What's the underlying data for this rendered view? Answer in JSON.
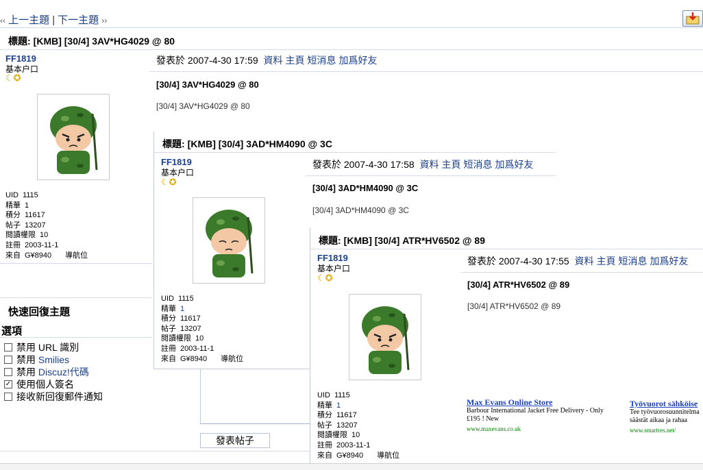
{
  "nav": {
    "prev_arrow": "‹‹",
    "prev_topic": "上一主題",
    "divider": "|",
    "next_topic": "下一主題",
    "next_arrow": "››"
  },
  "posts": [
    {
      "title_label": "標題:",
      "title": "[KMB] [30/4] 3AV*HG4029 @ 80",
      "username": "FF1819",
      "usergroup": "基本户口",
      "stats": [
        {
          "label": "UID",
          "value": "1115"
        },
        {
          "label": "精華",
          "value": "1"
        },
        {
          "label": "積分",
          "value": "11617"
        },
        {
          "label": "帖子",
          "value": "13207"
        },
        {
          "label": "閱讀權限",
          "value": "10"
        },
        {
          "label": "註冊",
          "value": "2003-11-1"
        },
        {
          "label": "來自",
          "value": "G¥8940"
        }
      ],
      "nav_label": "導航位",
      "posted_label": "發表於",
      "posted_time": "2007-4-30 17:59",
      "links": [
        "資料",
        "主頁",
        "短消息",
        "加爲好友"
      ],
      "msg_title": "[30/4] 3AV*HG4029 @ 80",
      "msg_body": "[30/4] 3AV*HG4029 @ 80"
    },
    {
      "title_label": "標題:",
      "title": "[KMB] [30/4] 3AD*HM4090 @ 3C",
      "username": "FF1819",
      "usergroup": "基本户口",
      "stats": [
        {
          "label": "UID",
          "value": "1115"
        },
        {
          "label": "精華",
          "value": "1"
        },
        {
          "label": "積分",
          "value": "11617"
        },
        {
          "label": "帖子",
          "value": "13207"
        },
        {
          "label": "閱讀權限",
          "value": "10"
        },
        {
          "label": "註冊",
          "value": "2003-11-1"
        },
        {
          "label": "來自",
          "value": "G¥8940"
        }
      ],
      "nav_label": "導航位",
      "posted_label": "發表於",
      "posted_time": "2007-4-30 17:58",
      "links": [
        "資料",
        "主頁",
        "短消息",
        "加爲好友"
      ],
      "msg_title": "[30/4] 3AD*HM4090 @ 3C",
      "msg_body": "[30/4] 3AD*HM4090 @ 3C"
    },
    {
      "title_label": "標題:",
      "title": "[KMB] [30/4] ATR*HV6502 @ 89",
      "username": "FF1819",
      "usergroup": "基本户口",
      "stats": [
        {
          "label": "UID",
          "value": "1115"
        },
        {
          "label": "精華",
          "value": "1"
        },
        {
          "label": "積分",
          "value": "11617"
        },
        {
          "label": "帖子",
          "value": "13207"
        },
        {
          "label": "閱讀權限",
          "value": "10"
        },
        {
          "label": "註冊",
          "value": "2003-11-1"
        },
        {
          "label": "來自",
          "value": "G¥8940"
        }
      ],
      "nav_label": "導航位",
      "posted_label": "發表於",
      "posted_time": "2007-4-30 17:55",
      "links": [
        "資料",
        "主頁",
        "短消息",
        "加爲好友"
      ],
      "msg_title": "[30/4] ATR*HV6502 @ 89",
      "msg_body": "[30/4] ATR*HV6502 @ 89"
    }
  ],
  "quick_reply": {
    "title": "快速回復主題",
    "options_title": "選項",
    "options": [
      {
        "prefix": "禁用",
        "label": "URL 識別",
        "checked": false
      },
      {
        "prefix": "禁用",
        "label": "Smilies",
        "checked": false
      },
      {
        "prefix": "禁用",
        "label": "Discuz!代碼",
        "checked": false
      },
      {
        "prefix": "",
        "label": "使用個人簽名",
        "checked": true
      },
      {
        "prefix": "",
        "label": "接收新回復郵件通知",
        "checked": false
      }
    ],
    "submit_label": "發表帖子"
  },
  "ads": [
    {
      "title": "Max Evans Online Store",
      "text": "Barbour International Jacket Free Delivery - Only £195 ! New",
      "url": "www.maxevans.co.uk"
    },
    {
      "title": "Työvuorot sähköise",
      "text": "Tee työvuorosuunnitelma säästät aikaa ja rahaa",
      "url": "www.smartres.net/"
    }
  ],
  "icons": {
    "moon": "☾",
    "star": "✪"
  },
  "colors": {
    "link": "#1a3f8c",
    "avatar_green": "#3b7a2a",
    "ad_title": "#1a3fbf",
    "ad_url": "#008000"
  }
}
